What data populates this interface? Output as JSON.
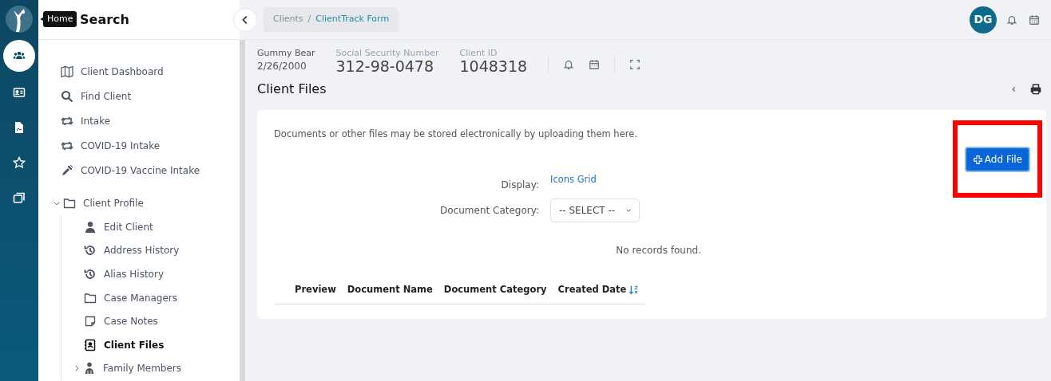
{
  "rail": {
    "items": [
      {
        "kind": "people",
        "selected": true
      },
      {
        "kind": "id-card",
        "selected": false
      },
      {
        "kind": "document",
        "selected": false
      },
      {
        "kind": "star",
        "selected": false
      },
      {
        "kind": "windows",
        "selected": false
      }
    ]
  },
  "tooltip": "Home",
  "sidebar": {
    "title": "Search",
    "items": [
      {
        "label": "Client Dashboard",
        "kind": "map",
        "selected": false
      },
      {
        "label": "Find Client",
        "kind": "search",
        "selected": false
      },
      {
        "label": "Intake",
        "kind": "repeat",
        "selected": false
      },
      {
        "label": "COVID-19 Intake",
        "kind": "repeat",
        "selected": false
      },
      {
        "label": "COVID-19 Vaccine Intake",
        "kind": "syringe",
        "selected": false
      }
    ],
    "tree": [
      {
        "label": "Client Profile",
        "kind": "folder",
        "expanded": true,
        "children": [
          {
            "label": "Edit Client",
            "kind": "person",
            "selected": false
          },
          {
            "label": "Address History",
            "kind": "history",
            "selected": false
          },
          {
            "label": "Alias History",
            "kind": "history",
            "selected": false
          },
          {
            "label": "Case Managers",
            "kind": "folder",
            "selected": false
          },
          {
            "label": "Case Notes",
            "kind": "note",
            "selected": false
          },
          {
            "label": "Client Files",
            "kind": "contact",
            "selected": true
          },
          {
            "label": "Family Members",
            "kind": "family",
            "selected": false,
            "expanded": false
          }
        ]
      }
    ]
  },
  "breadcrumb": [
    {
      "label": "Clients",
      "selected": false
    },
    {
      "label": "ClientTrack Form",
      "selected": true
    }
  ],
  "breadcrumb_separator": "/",
  "user": {
    "initials": "DG"
  },
  "client": {
    "name": "Gummy Bear",
    "dob": "2/26/2000",
    "fields": [
      {
        "label": "Social Security Number",
        "value": "312-98-0478"
      },
      {
        "label": "Client ID",
        "value": "1048318"
      }
    ]
  },
  "page_title": "Client Files",
  "card": {
    "intro": "Documents or other files may be stored electronically by uploading them here.",
    "add_button": {
      "label": "Add File",
      "highlighted": true
    },
    "display": {
      "label": "Display:",
      "value": "Icons Grid"
    },
    "category": {
      "label": "Document Category:",
      "value": "-- SELECT --"
    },
    "empty": "No records found.",
    "columns": [
      {
        "label": "Preview",
        "sorted": false
      },
      {
        "label": "Document Name",
        "sorted": false
      },
      {
        "label": "Document Category",
        "sorted": false
      },
      {
        "label": "Created Date",
        "sorted": true
      }
    ]
  }
}
